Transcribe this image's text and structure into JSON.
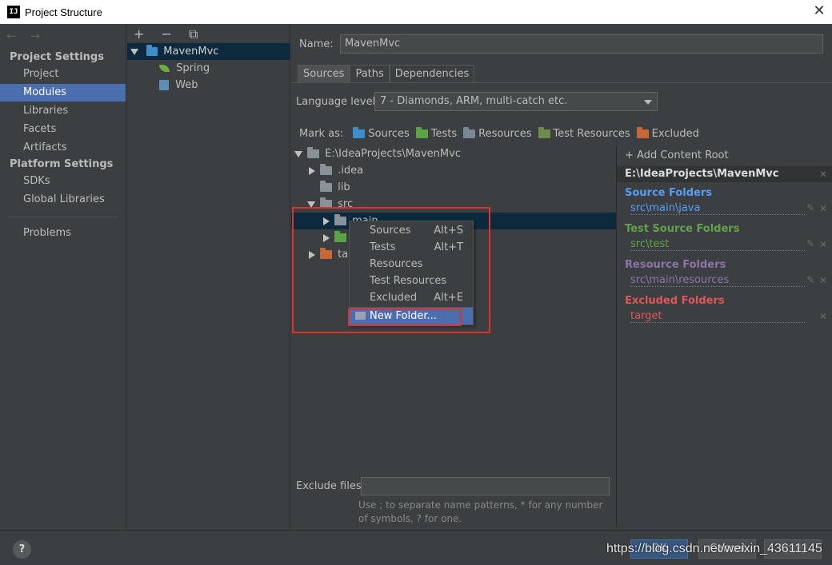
{
  "window": {
    "title": "Project Structure",
    "app_icon": "IJ"
  },
  "sidebar": {
    "nav_arrows": "← →",
    "project_settings_header": "Project Settings",
    "project_items": [
      "Project",
      "Modules",
      "Libraries",
      "Facets",
      "Artifacts"
    ],
    "selected_item": "Modules",
    "platform_settings_header": "Platform Settings",
    "platform_items": [
      "SDKs",
      "Global Libraries"
    ],
    "problems": "Problems"
  },
  "modules": {
    "toolbar": "+ − ⧉",
    "tree": [
      {
        "label": "MavenMvc",
        "icon": "module-icon"
      },
      {
        "label": "Spring",
        "icon": "spring-leaf-icon"
      },
      {
        "label": "Web",
        "icon": "web-icon"
      }
    ]
  },
  "main": {
    "name_label": "Name:",
    "name_value": "MavenMvc",
    "tabs": [
      "Sources",
      "Paths",
      "Dependencies"
    ],
    "active_tab": "Sources",
    "language_level_label": "Language level:",
    "language_level_value": "7 - Diamonds, ARM, multi-catch etc.",
    "mark_as_label": "Mark as:",
    "mark_as_options": [
      "Sources",
      "Tests",
      "Resources",
      "Test Resources",
      "Excluded"
    ],
    "tree": {
      "root": "E:\\IdeaProjects\\MavenMvc",
      "idea": ".idea",
      "lib": "lib",
      "src": "src",
      "main": "main",
      "target": "target"
    },
    "exclude_files_label": "Exclude files:",
    "exclude_hint": "Use ; to separate name patterns, * for any number of symbols, ? for one."
  },
  "content_roots": {
    "add_label": "+ Add Content Root",
    "root_path": "E:\\IdeaProjects\\MavenMvc",
    "source_folders_label": "Source Folders",
    "source_folder": "src\\main\\java",
    "test_source_folders_label": "Test Source Folders",
    "test_source_folder": "src\\test",
    "resource_folders_label": "Resource Folders",
    "resource_folder": "src\\main\\resources",
    "excluded_folders_label": "Excluded Folders",
    "excluded_folder": "target"
  },
  "context_menu": {
    "items": [
      {
        "label": "Sources",
        "shortcut": "Alt+S"
      },
      {
        "label": "Tests",
        "shortcut": "Alt+T"
      },
      {
        "label": "Resources",
        "shortcut": ""
      },
      {
        "label": "Test Resources",
        "shortcut": ""
      },
      {
        "label": "Excluded",
        "shortcut": "Alt+E"
      }
    ],
    "new_folder": "New Folder..."
  },
  "bottom": {
    "help": "?",
    "ok": "OK",
    "cancel": "Cancel",
    "apply": "Apply",
    "watermark": "https://blog.csdn.net/weixin_43611145"
  },
  "colors": {
    "selection": "#4b6eaf",
    "source": "#589df6",
    "test": "#62a24b",
    "resource": "#8e74a9",
    "excluded": "#e05555",
    "highlight_box": "#e2302b"
  }
}
